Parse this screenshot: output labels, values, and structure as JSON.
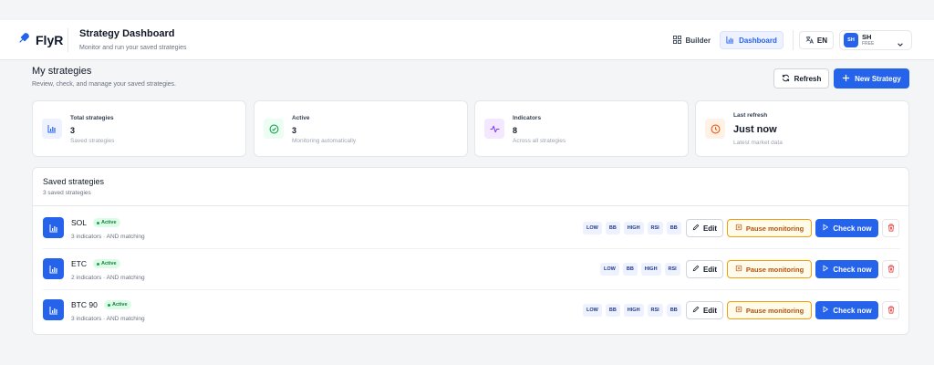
{
  "header": {
    "brand": "FlyR",
    "title": "Strategy Dashboard",
    "subtitle": "Monitor and run your saved strategies",
    "nav": [
      {
        "label": "Builder",
        "icon": "grid-icon",
        "active": false
      },
      {
        "label": "Dashboard",
        "icon": "bar-chart-icon",
        "active": true
      }
    ],
    "language": "EN",
    "user": {
      "initials": "SH",
      "name": "SH",
      "plan": "FREE"
    }
  },
  "page": {
    "title": "My strategies",
    "subtitle": "Review, check, and manage your saved strategies.",
    "refresh_label": "Refresh",
    "new_label": "New Strategy"
  },
  "stats": [
    {
      "label": "Total strategies",
      "value": "3",
      "note": "Saved strategies",
      "icon": "bar-chart-icon",
      "color": "#2563eb"
    },
    {
      "label": "Active",
      "value": "3",
      "note": "Monitoring automatically",
      "icon": "check-circle-icon",
      "color": "#16a34a"
    },
    {
      "label": "Indicators",
      "value": "8",
      "note": "Across all strategies",
      "icon": "activity-icon",
      "color": "#7c3aed"
    },
    {
      "label": "Last refresh",
      "value": "Just now",
      "note": "Latest market data",
      "icon": "clock-icon",
      "color": "#ea580c"
    }
  ],
  "saved": {
    "title": "Saved strategies",
    "subtitle": "3 saved strategies",
    "actions": {
      "edit": "Edit",
      "pause": "Pause monitoring",
      "check": "Check now"
    },
    "rows": [
      {
        "name": "SOL",
        "status": "Active",
        "meta": "3 indicators · AND matching",
        "tags": [
          "LOW",
          "BB",
          "HIGH",
          "RSI",
          "BB"
        ]
      },
      {
        "name": "ETC",
        "status": "Active",
        "meta": "2 indicators · AND matching",
        "tags": [
          "LOW",
          "BB",
          "HIGH",
          "RSI"
        ]
      },
      {
        "name": "BTC 90",
        "status": "Active",
        "meta": "3 indicators · AND matching",
        "tags": [
          "LOW",
          "BB",
          "HIGH",
          "RSI",
          "BB"
        ]
      }
    ]
  },
  "colors": {
    "accent": "#2563eb",
    "active": "#16a34a",
    "warning": "#b45309",
    "danger": "#dc2626"
  }
}
